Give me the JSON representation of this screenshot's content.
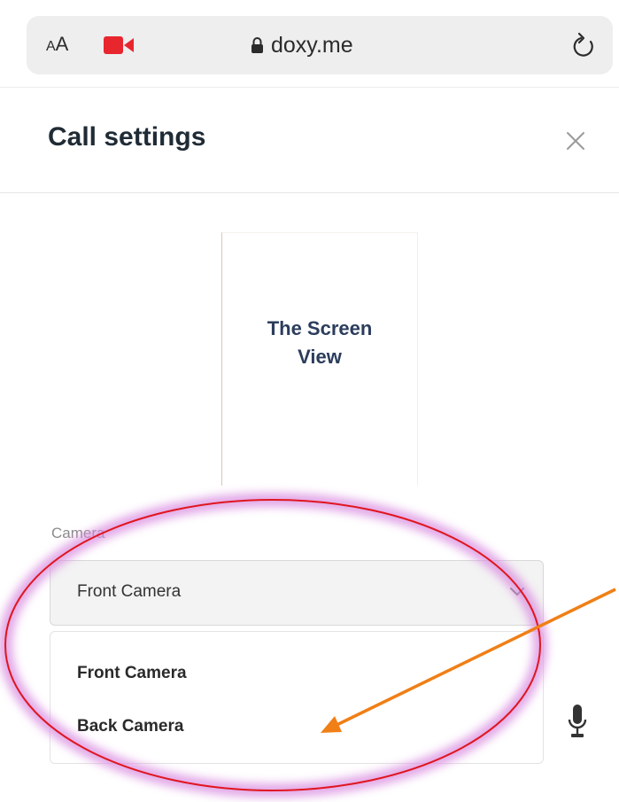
{
  "browser": {
    "text_size_label_small": "A",
    "text_size_label_large": "A",
    "url": "doxy.me",
    "icons": {
      "recording": "video-camera-icon",
      "lock": "lock-icon",
      "reload": "reload-icon"
    },
    "recording_color": "#e8262e"
  },
  "modal": {
    "title": "Call settings",
    "close_icon": "close-icon"
  },
  "preview": {
    "label": "The Screen\nView",
    "label_color": "#2b3d5c"
  },
  "camera": {
    "label": "Camera",
    "selected": "Front Camera",
    "options": [
      "Front Camera",
      "Back Camera"
    ]
  },
  "microphone": {
    "icon": "microphone-icon"
  },
  "annotations": {
    "highlight_color": "#e0161f",
    "glow_color": "#d98be0",
    "arrow_color": "#f07f16"
  }
}
